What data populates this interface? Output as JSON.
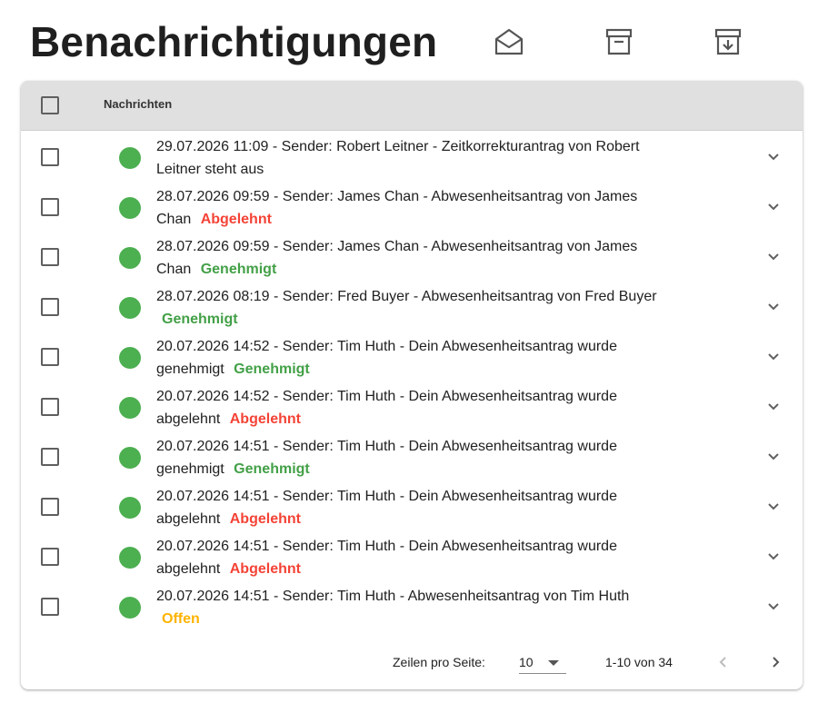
{
  "page": {
    "title": "Benachrichtigungen"
  },
  "toolbar": {
    "icons": [
      "mail-open-icon",
      "archive-icon",
      "unarchive-icon"
    ]
  },
  "table": {
    "column_header": "Nachrichten",
    "rows": [
      {
        "text": "29.07.2026 11:09 - Sender: Robert Leitner - Zeitkorrekturantrag von Robert Leitner steht aus",
        "status": "",
        "status_color": ""
      },
      {
        "text": "28.07.2026 09:59 - Sender: James Chan - Abwesenheitsantrag von James Chan",
        "status": "Abgelehnt",
        "status_color": "#f44336"
      },
      {
        "text": "28.07.2026 09:59 - Sender: James Chan - Abwesenheitsantrag von James Chan",
        "status": "Genehmigt",
        "status_color": "#43a047"
      },
      {
        "text": "28.07.2026 08:19 - Sender: Fred Buyer - Abwesenheitsantrag von Fred Buyer",
        "status": "Genehmigt",
        "status_color": "#43a047"
      },
      {
        "text": "20.07.2026 14:52 - Sender: Tim Huth - Dein Abwesenheitsantrag wurde genehmigt",
        "status": "Genehmigt",
        "status_color": "#43a047"
      },
      {
        "text": "20.07.2026 14:52 - Sender: Tim Huth - Dein Abwesenheitsantrag wurde abgelehnt",
        "status": "Abgelehnt",
        "status_color": "#f44336"
      },
      {
        "text": "20.07.2026 14:51 - Sender: Tim Huth - Dein Abwesenheitsantrag wurde genehmigt",
        "status": "Genehmigt",
        "status_color": "#43a047"
      },
      {
        "text": "20.07.2026 14:51 - Sender: Tim Huth - Dein Abwesenheitsantrag wurde abgelehnt",
        "status": "Abgelehnt",
        "status_color": "#f44336"
      },
      {
        "text": "20.07.2026 14:51 - Sender: Tim Huth - Dein Abwesenheitsantrag wurde abgelehnt",
        "status": "Abgelehnt",
        "status_color": "#f44336"
      },
      {
        "text": "20.07.2026 14:51 - Sender: Tim Huth - Abwesenheitsantrag von Tim Huth",
        "status": "Offen",
        "status_color": "#ffb300"
      }
    ],
    "unread_dot_color": "#4caf50"
  },
  "pagination": {
    "rows_per_page_label": "Zeilen pro Seite:",
    "rows_per_page_value": "10",
    "range_text": "1-10 von 34"
  }
}
